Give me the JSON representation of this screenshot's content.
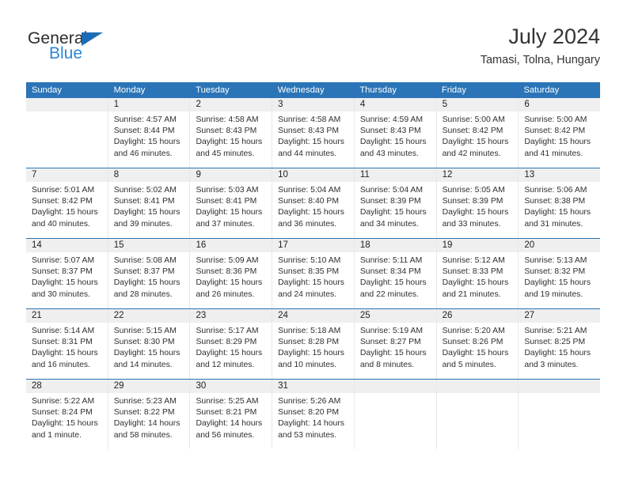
{
  "brand": {
    "name_part1": "General",
    "name_part2": "Blue",
    "triangle_color": "#1c6cb5",
    "blue_text_color": "#2a87d8"
  },
  "header": {
    "title": "July 2024",
    "subtitle": "Tamasi, Tolna, Hungary"
  },
  "theme": {
    "header_blue": "#2a74b7",
    "week_divider": "#2a74b7",
    "daynum_band": "#efefef",
    "cell_border": "#e8e8e8"
  },
  "weekdays": [
    "Sunday",
    "Monday",
    "Tuesday",
    "Wednesday",
    "Thursday",
    "Friday",
    "Saturday"
  ],
  "weeks": [
    [
      {
        "day": "",
        "l1": "",
        "l2": "",
        "l3": "",
        "l4": "",
        "empty": true
      },
      {
        "day": "1",
        "l1": "Sunrise: 4:57 AM",
        "l2": "Sunset: 8:44 PM",
        "l3": "Daylight: 15 hours",
        "l4": "and 46 minutes."
      },
      {
        "day": "2",
        "l1": "Sunrise: 4:58 AM",
        "l2": "Sunset: 8:43 PM",
        "l3": "Daylight: 15 hours",
        "l4": "and 45 minutes."
      },
      {
        "day": "3",
        "l1": "Sunrise: 4:58 AM",
        "l2": "Sunset: 8:43 PM",
        "l3": "Daylight: 15 hours",
        "l4": "and 44 minutes."
      },
      {
        "day": "4",
        "l1": "Sunrise: 4:59 AM",
        "l2": "Sunset: 8:43 PM",
        "l3": "Daylight: 15 hours",
        "l4": "and 43 minutes."
      },
      {
        "day": "5",
        "l1": "Sunrise: 5:00 AM",
        "l2": "Sunset: 8:42 PM",
        "l3": "Daylight: 15 hours",
        "l4": "and 42 minutes."
      },
      {
        "day": "6",
        "l1": "Sunrise: 5:00 AM",
        "l2": "Sunset: 8:42 PM",
        "l3": "Daylight: 15 hours",
        "l4": "and 41 minutes."
      }
    ],
    [
      {
        "day": "7",
        "l1": "Sunrise: 5:01 AM",
        "l2": "Sunset: 8:42 PM",
        "l3": "Daylight: 15 hours",
        "l4": "and 40 minutes."
      },
      {
        "day": "8",
        "l1": "Sunrise: 5:02 AM",
        "l2": "Sunset: 8:41 PM",
        "l3": "Daylight: 15 hours",
        "l4": "and 39 minutes."
      },
      {
        "day": "9",
        "l1": "Sunrise: 5:03 AM",
        "l2": "Sunset: 8:41 PM",
        "l3": "Daylight: 15 hours",
        "l4": "and 37 minutes."
      },
      {
        "day": "10",
        "l1": "Sunrise: 5:04 AM",
        "l2": "Sunset: 8:40 PM",
        "l3": "Daylight: 15 hours",
        "l4": "and 36 minutes."
      },
      {
        "day": "11",
        "l1": "Sunrise: 5:04 AM",
        "l2": "Sunset: 8:39 PM",
        "l3": "Daylight: 15 hours",
        "l4": "and 34 minutes."
      },
      {
        "day": "12",
        "l1": "Sunrise: 5:05 AM",
        "l2": "Sunset: 8:39 PM",
        "l3": "Daylight: 15 hours",
        "l4": "and 33 minutes."
      },
      {
        "day": "13",
        "l1": "Sunrise: 5:06 AM",
        "l2": "Sunset: 8:38 PM",
        "l3": "Daylight: 15 hours",
        "l4": "and 31 minutes."
      }
    ],
    [
      {
        "day": "14",
        "l1": "Sunrise: 5:07 AM",
        "l2": "Sunset: 8:37 PM",
        "l3": "Daylight: 15 hours",
        "l4": "and 30 minutes."
      },
      {
        "day": "15",
        "l1": "Sunrise: 5:08 AM",
        "l2": "Sunset: 8:37 PM",
        "l3": "Daylight: 15 hours",
        "l4": "and 28 minutes."
      },
      {
        "day": "16",
        "l1": "Sunrise: 5:09 AM",
        "l2": "Sunset: 8:36 PM",
        "l3": "Daylight: 15 hours",
        "l4": "and 26 minutes."
      },
      {
        "day": "17",
        "l1": "Sunrise: 5:10 AM",
        "l2": "Sunset: 8:35 PM",
        "l3": "Daylight: 15 hours",
        "l4": "and 24 minutes."
      },
      {
        "day": "18",
        "l1": "Sunrise: 5:11 AM",
        "l2": "Sunset: 8:34 PM",
        "l3": "Daylight: 15 hours",
        "l4": "and 22 minutes."
      },
      {
        "day": "19",
        "l1": "Sunrise: 5:12 AM",
        "l2": "Sunset: 8:33 PM",
        "l3": "Daylight: 15 hours",
        "l4": "and 21 minutes."
      },
      {
        "day": "20",
        "l1": "Sunrise: 5:13 AM",
        "l2": "Sunset: 8:32 PM",
        "l3": "Daylight: 15 hours",
        "l4": "and 19 minutes."
      }
    ],
    [
      {
        "day": "21",
        "l1": "Sunrise: 5:14 AM",
        "l2": "Sunset: 8:31 PM",
        "l3": "Daylight: 15 hours",
        "l4": "and 16 minutes."
      },
      {
        "day": "22",
        "l1": "Sunrise: 5:15 AM",
        "l2": "Sunset: 8:30 PM",
        "l3": "Daylight: 15 hours",
        "l4": "and 14 minutes."
      },
      {
        "day": "23",
        "l1": "Sunrise: 5:17 AM",
        "l2": "Sunset: 8:29 PM",
        "l3": "Daylight: 15 hours",
        "l4": "and 12 minutes."
      },
      {
        "day": "24",
        "l1": "Sunrise: 5:18 AM",
        "l2": "Sunset: 8:28 PM",
        "l3": "Daylight: 15 hours",
        "l4": "and 10 minutes."
      },
      {
        "day": "25",
        "l1": "Sunrise: 5:19 AM",
        "l2": "Sunset: 8:27 PM",
        "l3": "Daylight: 15 hours",
        "l4": "and 8 minutes."
      },
      {
        "day": "26",
        "l1": "Sunrise: 5:20 AM",
        "l2": "Sunset: 8:26 PM",
        "l3": "Daylight: 15 hours",
        "l4": "and 5 minutes."
      },
      {
        "day": "27",
        "l1": "Sunrise: 5:21 AM",
        "l2": "Sunset: 8:25 PM",
        "l3": "Daylight: 15 hours",
        "l4": "and 3 minutes."
      }
    ],
    [
      {
        "day": "28",
        "l1": "Sunrise: 5:22 AM",
        "l2": "Sunset: 8:24 PM",
        "l3": "Daylight: 15 hours",
        "l4": "and 1 minute."
      },
      {
        "day": "29",
        "l1": "Sunrise: 5:23 AM",
        "l2": "Sunset: 8:22 PM",
        "l3": "Daylight: 14 hours",
        "l4": "and 58 minutes."
      },
      {
        "day": "30",
        "l1": "Sunrise: 5:25 AM",
        "l2": "Sunset: 8:21 PM",
        "l3": "Daylight: 14 hours",
        "l4": "and 56 minutes."
      },
      {
        "day": "31",
        "l1": "Sunrise: 5:26 AM",
        "l2": "Sunset: 8:20 PM",
        "l3": "Daylight: 14 hours",
        "l4": "and 53 minutes."
      },
      {
        "day": "",
        "l1": "",
        "l2": "",
        "l3": "",
        "l4": "",
        "empty": true
      },
      {
        "day": "",
        "l1": "",
        "l2": "",
        "l3": "",
        "l4": "",
        "empty": true
      },
      {
        "day": "",
        "l1": "",
        "l2": "",
        "l3": "",
        "l4": "",
        "empty": true
      }
    ]
  ]
}
